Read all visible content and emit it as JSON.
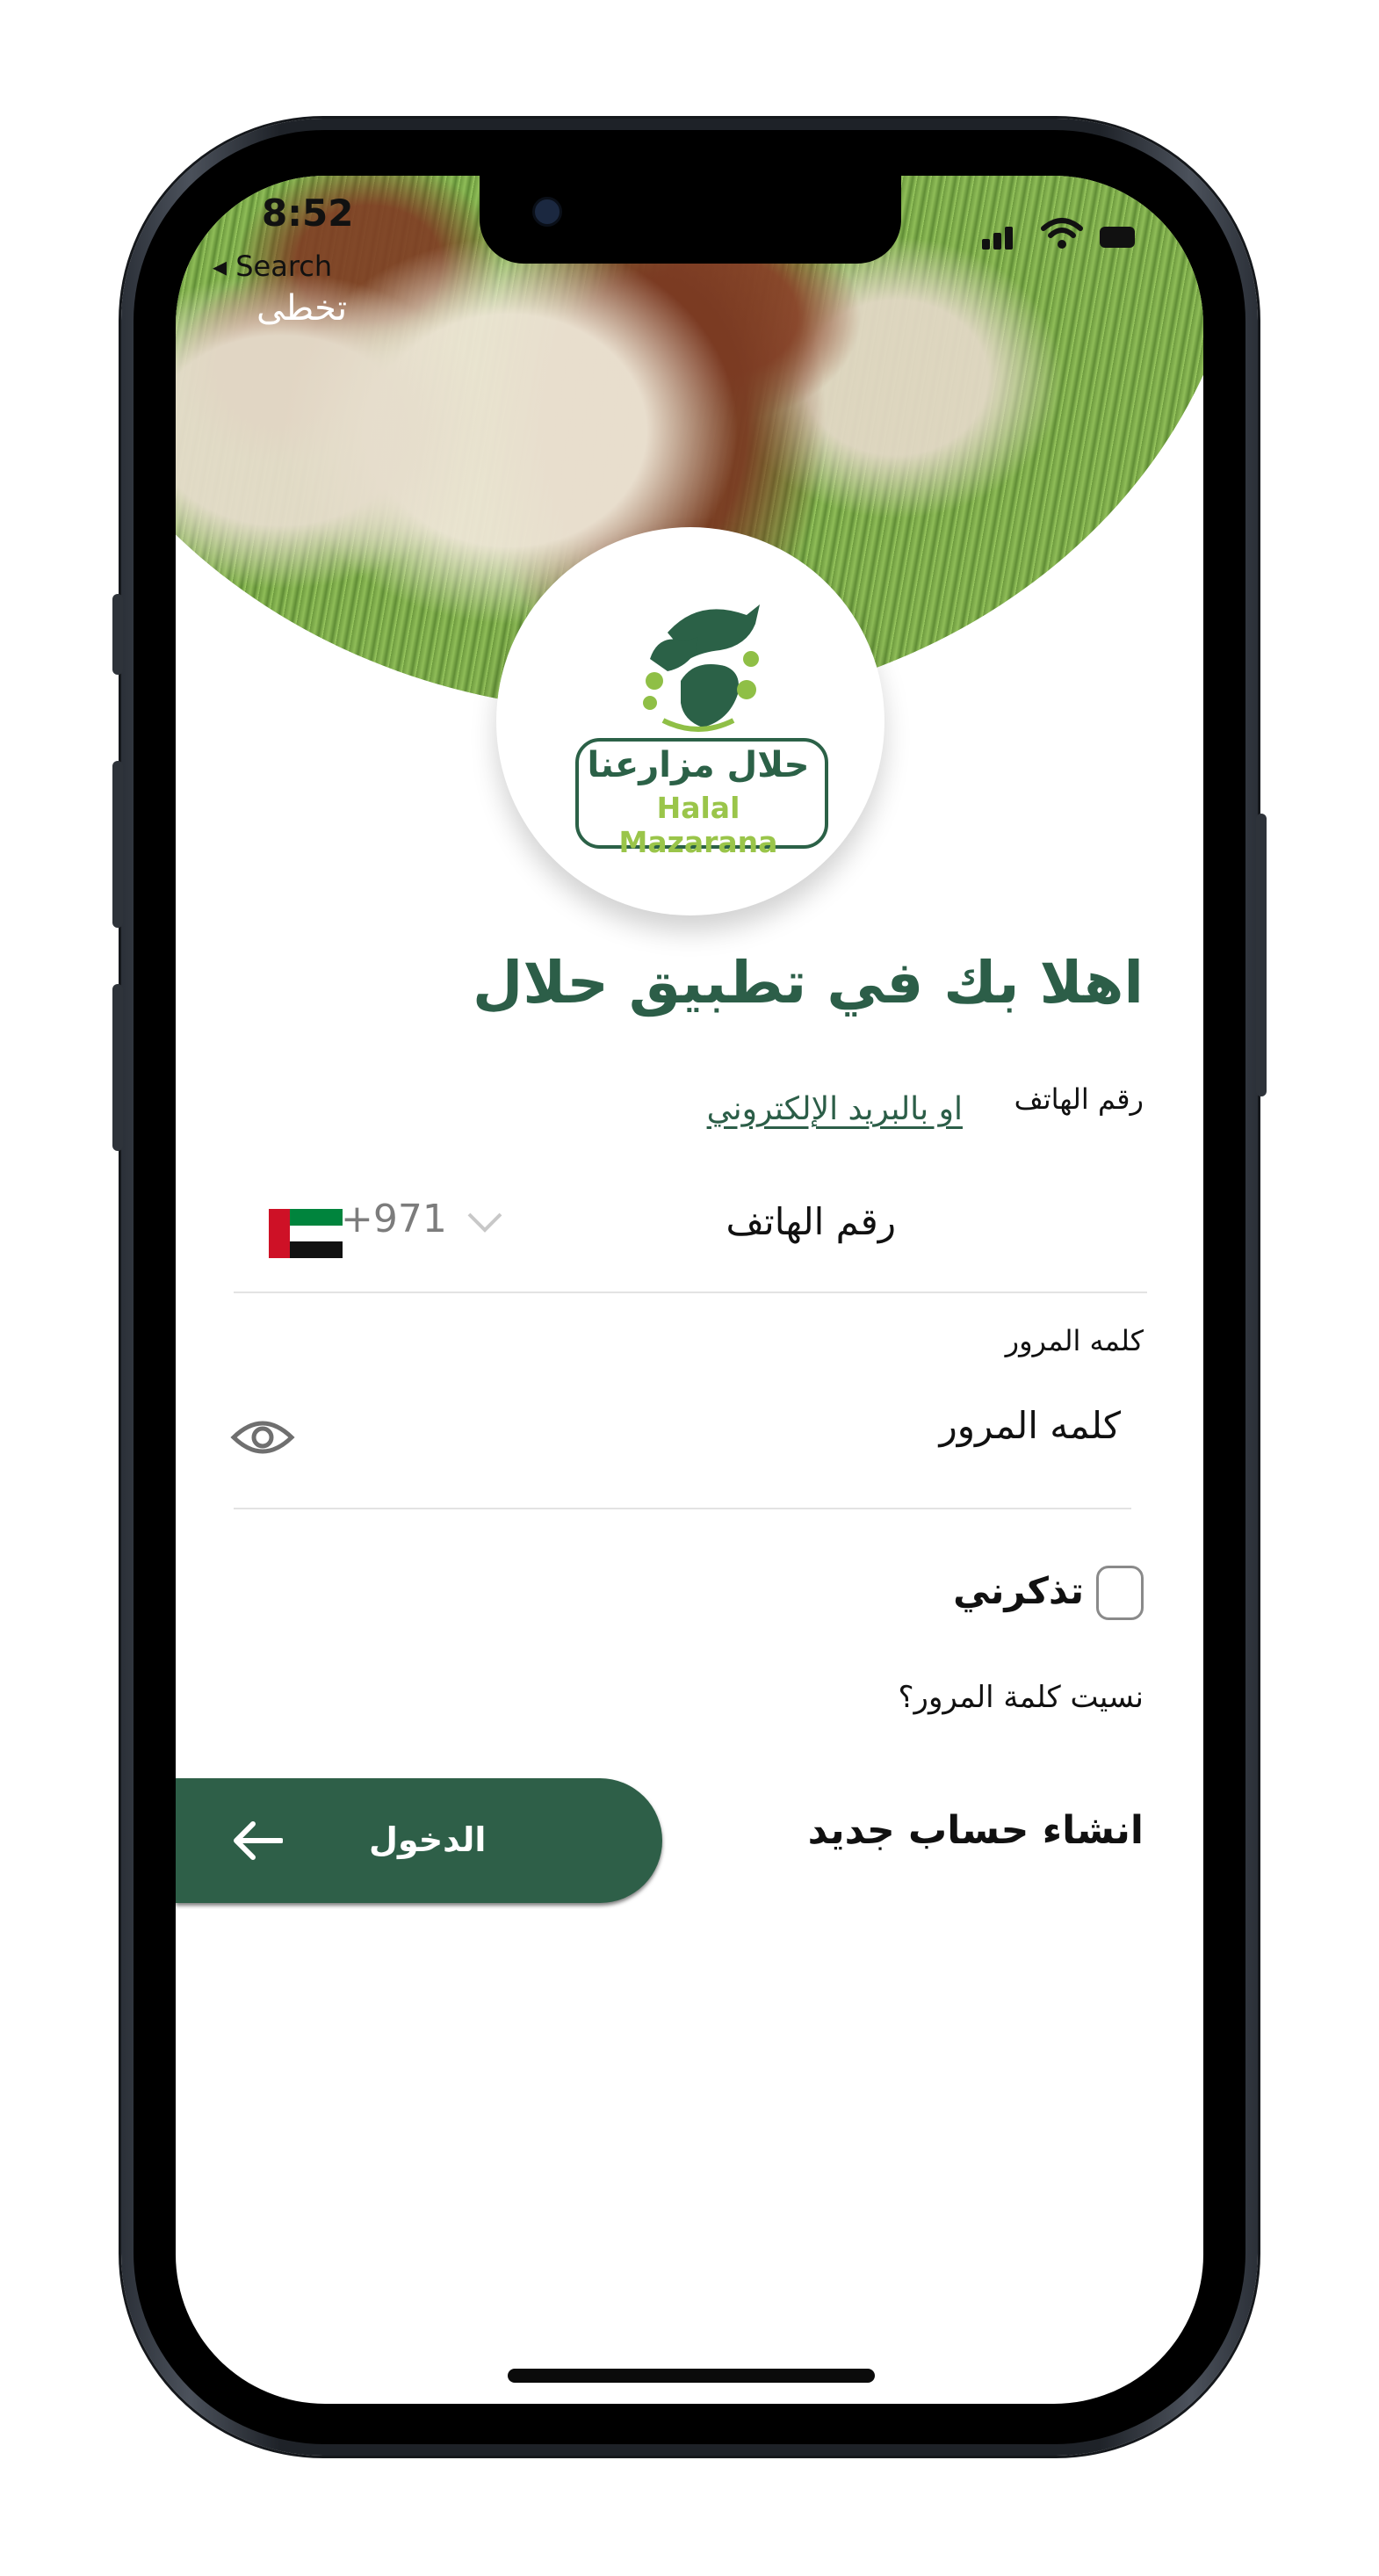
{
  "status_bar": {
    "time": "8:52",
    "back_label": "◂ Search",
    "skip_label": "تخطى"
  },
  "logo": {
    "arabic": "حلال مزارعنا",
    "english": "Halal Mazarana"
  },
  "welcome": {
    "title": "اهلا بك في تطبيق حلال"
  },
  "login_mode": {
    "phone_label": "رقم الهاتف",
    "email_link": "او بالبريد الإلكتروني"
  },
  "phone_field": {
    "placeholder": "رقم الهاتف",
    "country_code": "+971",
    "country_flag": "uae-flag"
  },
  "password_field": {
    "label": "كلمه المرور",
    "placeholder": "كلمه المرور"
  },
  "remember_me": {
    "label": "تذكرني",
    "checked": false
  },
  "forgot_password": {
    "label": "نسيت كلمة المرور؟"
  },
  "actions": {
    "login_label": "الدخول",
    "create_account_label": "انشاء حساب جديد"
  },
  "colors": {
    "brand_green": "#2e5f48",
    "logo_lime": "#9ac54a"
  }
}
